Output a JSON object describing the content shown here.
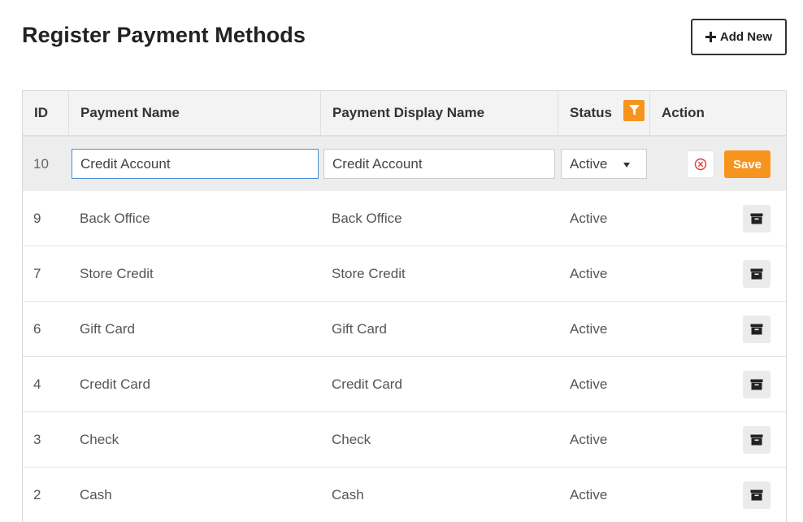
{
  "page": {
    "title": "Register Payment Methods",
    "add_button_label": "Add New"
  },
  "colors": {
    "accent": "#f7941d",
    "header_bg": "#f4f3f3",
    "editing_row_bg": "#ededed",
    "focus_border": "#4a8fd6",
    "cancel_icon": "#e23b3b"
  },
  "table": {
    "headers": {
      "id": "ID",
      "name": "Payment Name",
      "display_name": "Payment Display Name",
      "status": "Status",
      "action": "Action"
    },
    "editing_row": {
      "id": "10",
      "name_value": "Credit Account",
      "display_name_value": "Credit Account",
      "status_value": "Active",
      "save_label": "Save"
    },
    "rows": [
      {
        "id": "9",
        "name": "Back Office",
        "display_name": "Back Office",
        "status": "Active"
      },
      {
        "id": "7",
        "name": "Store Credit",
        "display_name": "Store Credit",
        "status": "Active"
      },
      {
        "id": "6",
        "name": "Gift Card",
        "display_name": "Gift Card",
        "status": "Active"
      },
      {
        "id": "4",
        "name": "Credit Card",
        "display_name": "Credit Card",
        "status": "Active"
      },
      {
        "id": "3",
        "name": "Check",
        "display_name": "Check",
        "status": "Active"
      },
      {
        "id": "2",
        "name": "Cash",
        "display_name": "Cash",
        "status": "Active"
      }
    ]
  },
  "icons": {
    "add": "plus-icon",
    "filter": "filter-icon",
    "cancel": "cancel-circle-icon",
    "archive": "archive-icon",
    "dropdown": "caret-down-icon"
  }
}
